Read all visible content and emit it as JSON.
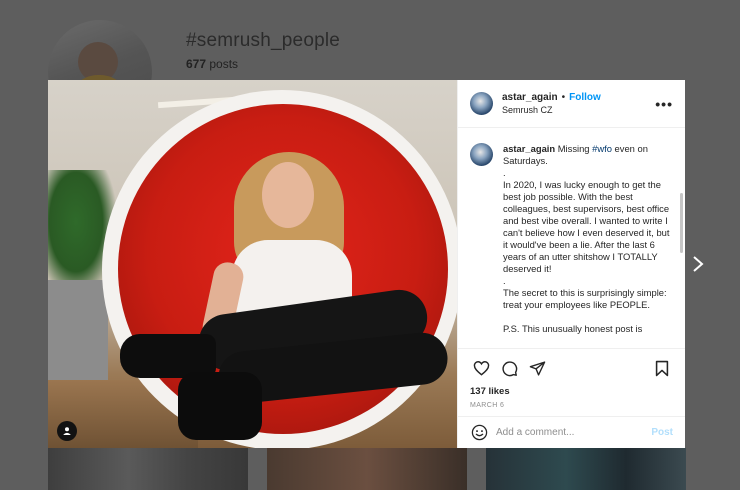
{
  "background_page": {
    "hashtag_title": "#semrush_people",
    "posts_count": "677",
    "posts_label": "posts"
  },
  "post": {
    "author": "astar_again",
    "separator": "•",
    "follow_label": "Follow",
    "location": "Semrush CZ",
    "more_icon": "more-horizontal-icon",
    "caption": {
      "username": "astar_again",
      "line1_pre": "Missing ",
      "hashtag": "#wfo",
      "line1_post": " even on Saturdays.",
      "p_dot1": ".",
      "p1": "In 2020, I was lucky enough to get the best job possible. With the best colleagues, best supervisors, best office and best vibe overall. I wanted to write I can't believe how I even deserved it, but it would've been a lie. After the last 6 years of an utter shitshow I TOTALLY deserved it!",
      "p_dot2": ".",
      "p2": "The secret to this is surprisingly simple: treat your employees like PEOPLE.",
      "p3": "P.S. This unusually honest post is"
    },
    "likes": "137 likes",
    "date": "MARCH 6",
    "comment_placeholder": "Add a comment...",
    "post_button": "Post"
  },
  "colors": {
    "accent": "#0095f6",
    "post_disabled": "#b2dffc",
    "overlay": "#5e5e5e"
  }
}
